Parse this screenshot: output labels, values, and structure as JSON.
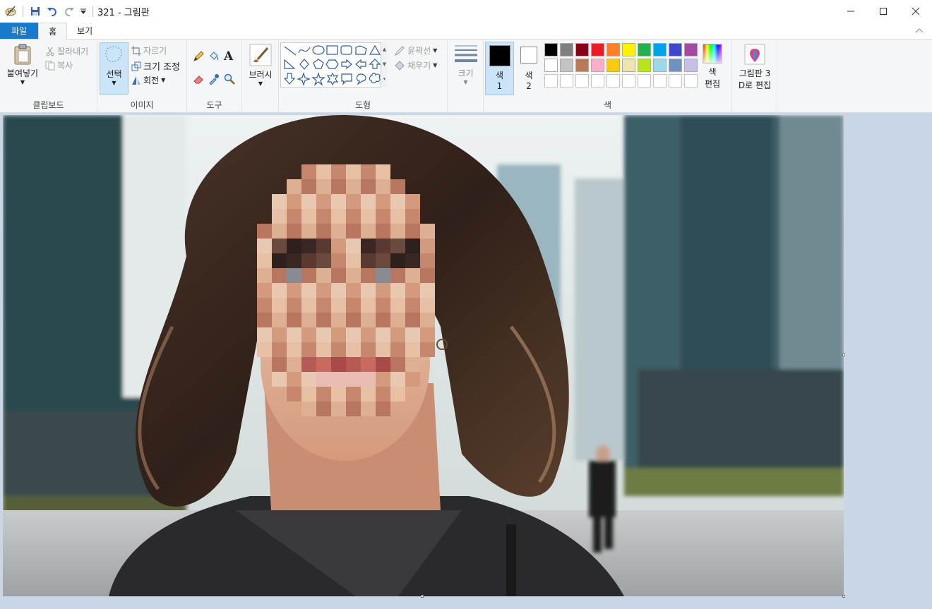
{
  "titlebar": {
    "title": "321 - 그림판",
    "icons": [
      "paint-app-icon",
      "save-icon",
      "undo-icon",
      "redo-icon",
      "customize-qa-icon"
    ]
  },
  "tabs": {
    "file": "파일",
    "home": "홈",
    "view": "보기"
  },
  "clipboard": {
    "paste": "붙여넣기",
    "cut": "잘라내기",
    "copy": "복사",
    "label": "클립보드"
  },
  "image": {
    "select": "선택",
    "crop": "자르기",
    "resize": "크기 조정",
    "rotate": "회전",
    "label": "이미지"
  },
  "tools": {
    "label": "도구"
  },
  "brushes": {
    "label": "브러시"
  },
  "shapes": {
    "outline": "윤곽선",
    "fill": "채우기",
    "label": "도형"
  },
  "size": {
    "label": "크기"
  },
  "colors": {
    "color1": "색",
    "color1_num": "1",
    "color2": "색",
    "color2_num": "2",
    "edit": "색",
    "edit2": "편집",
    "label": "색",
    "color1_value": "#000000",
    "color2_value": "#ffffff",
    "row1": [
      "#000000",
      "#7f7f7f",
      "#880015",
      "#ed1c24",
      "#ff7f27",
      "#fff200",
      "#22b14c",
      "#00a2e8",
      "#3f48cc",
      "#a349a4"
    ],
    "row2": [
      "#ffffff",
      "#c3c3c3",
      "#b97a57",
      "#ffaec9",
      "#ffc90e",
      "#efe4b0",
      "#b5e61d",
      "#99d9ea",
      "#7092be",
      "#c8bfe7"
    ],
    "row3": [
      "#ffffff",
      "#ffffff",
      "#ffffff",
      "#ffffff",
      "#ffffff",
      "#ffffff",
      "#ffffff",
      "#ffffff",
      "#ffffff",
      "#ffffff"
    ]
  },
  "paint3d": {
    "line1": "그림판 3",
    "line2": "D로 편집"
  }
}
